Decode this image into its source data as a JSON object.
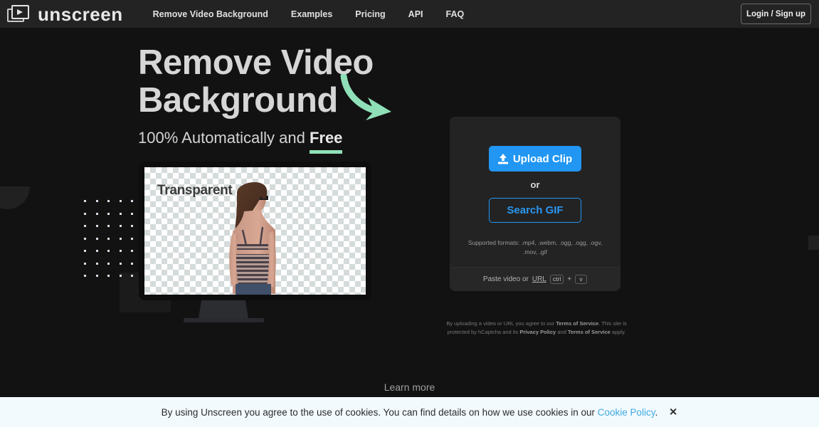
{
  "brand": {
    "name": "unscreen",
    "logo_icon": "video-play-stack-icon"
  },
  "nav": {
    "links": [
      {
        "label": "Remove Video Background"
      },
      {
        "label": "Examples"
      },
      {
        "label": "Pricing"
      },
      {
        "label": "API"
      },
      {
        "label": "FAQ"
      }
    ],
    "login_label": "Login / Sign up"
  },
  "hero": {
    "heading_line1": "Remove Video",
    "heading_line2": "Background",
    "sub_prefix": "100% Automatically and ",
    "sub_highlight": "Free",
    "arrow_icon": "curved-arrow-icon",
    "arrow_color": "#8fe0b8",
    "underline_color": "#8fe0b8"
  },
  "preview": {
    "screen_label": "Transparent",
    "device": "monitor-mockup"
  },
  "upload_card": {
    "upload_label": "Upload Clip",
    "upload_icon": "upload-icon",
    "or_label": "or",
    "search_label": "Search GIF",
    "formats_text": "Supported formats: .mp4, .webm, .ogg, .ogg, .ogv, .mov, .gif",
    "paste_prefix": "Paste video or ",
    "paste_link": "URL",
    "key_ctrl": "ctrl",
    "key_plus": "+",
    "key_v": "v",
    "accent_color": "#2196f3"
  },
  "terms": {
    "part1": "By uploading a video or URL you agree to our ",
    "tos1": "Terms of Service",
    "part2": ". This site is protected by hCaptcha and its ",
    "privacy": "Privacy Policy",
    "part3": " and ",
    "tos2": "Terms of Service",
    "part4": " apply."
  },
  "learn_more": {
    "label": "Learn more",
    "chevron_icon": "chevron-down-icon"
  },
  "cookie_banner": {
    "text_before": "By using Unscreen you agree to the use of cookies. You can find details on how we use cookies in our ",
    "link_label": "Cookie Policy",
    "text_after": ".",
    "close_label": "✕",
    "close_icon": "close-icon",
    "background": "#f3fafd",
    "link_color": "#3eaae0"
  }
}
